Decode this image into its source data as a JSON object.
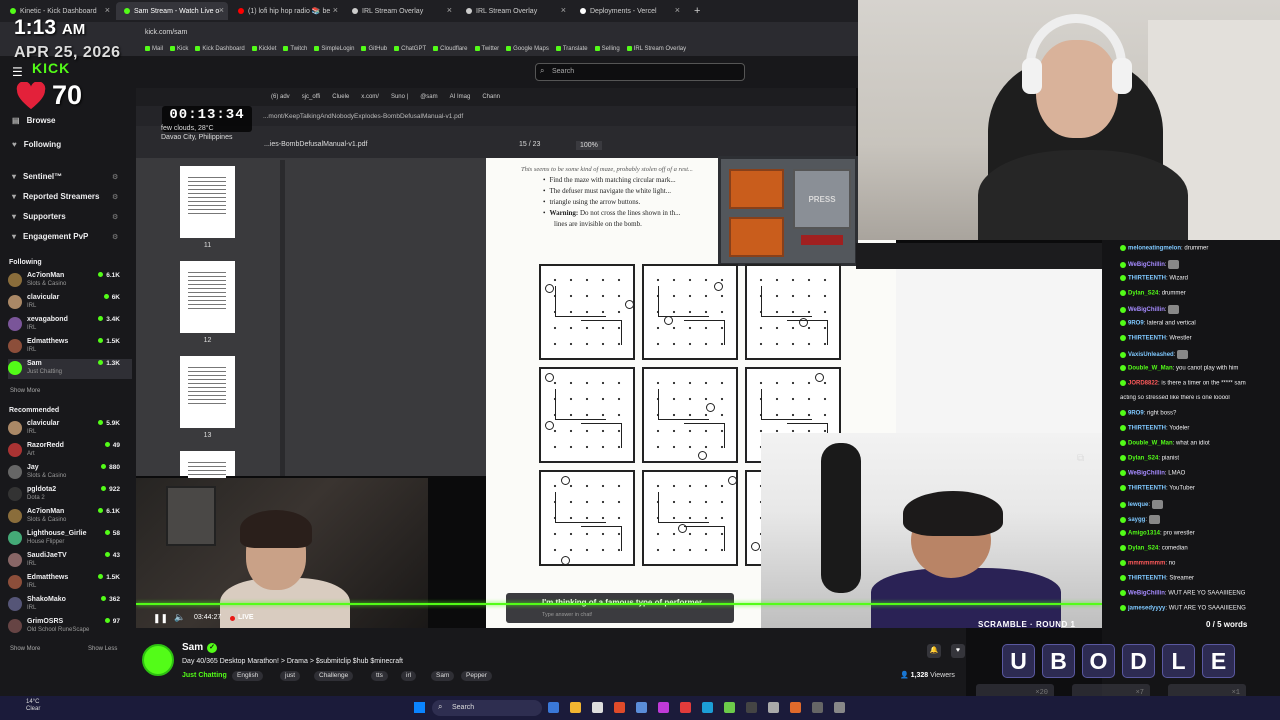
{
  "overlay": {
    "time": "1:13",
    "ampm": "AM",
    "date": "APR 25, 2026",
    "heart_rate": "70"
  },
  "browser": {
    "tabs": [
      {
        "label": "Kinetic - Kick Dashboard",
        "color": "#53fc18"
      },
      {
        "label": "Sam Stream - Watch Live o",
        "color": "#53fc18"
      },
      {
        "label": "(1) lofi hip hop radio 📚 be",
        "color": "#ff0000"
      },
      {
        "label": "IRL Stream Overlay",
        "color": "#cccccc"
      },
      {
        "label": "IRL Stream Overlay",
        "color": "#cccccc"
      },
      {
        "label": "Deployments - Vercel",
        "color": "#ffffff"
      }
    ],
    "new_tab": "+",
    "url": "kick.com/sam",
    "bookmarks": [
      "Mail",
      "Kick",
      "Kick Dashboard",
      "Kicklet",
      "Twitch",
      "SimpleLogin",
      "GitHub",
      "ChatGPT",
      "Cloudflare",
      "Twitter",
      "Google Maps",
      "Translate",
      "Selling",
      "IRL Stream Overlay"
    ]
  },
  "kick": {
    "logo": "KICK",
    "search_placeholder": "Search"
  },
  "sidebar": {
    "nav": [
      {
        "label": "Browse",
        "icon": "▤"
      },
      {
        "label": "Following",
        "icon": "♥"
      }
    ],
    "sections": [
      "Sentinel™",
      "Reported Streamers",
      "Supporters",
      "Engagement PvP"
    ],
    "following_title": "Following",
    "following": [
      {
        "name": "Ac7ionMan",
        "cat": "Slots & Casino",
        "viewers": "6.1K",
        "color": "#8a6d3b"
      },
      {
        "name": "clavicular",
        "cat": "IRL",
        "viewers": "6K",
        "color": "#aa8866"
      },
      {
        "name": "xevagabond",
        "cat": "IRL",
        "viewers": "3.4K",
        "color": "#7a5599"
      },
      {
        "name": "Edmatthews",
        "cat": "IRL",
        "viewers": "1.5K",
        "color": "#8c4e3a"
      },
      {
        "name": "Sam",
        "cat": "Just Chatting",
        "viewers": "1.3K",
        "color": "#53fc18"
      }
    ],
    "show_more": "Show More",
    "recommended_title": "Recommended",
    "recommended": [
      {
        "name": "clavicular",
        "cat": "IRL",
        "viewers": "5.9K",
        "color": "#aa8866"
      },
      {
        "name": "RazorRedd",
        "cat": "Art",
        "viewers": "49",
        "color": "#a33"
      },
      {
        "name": "Jay",
        "cat": "Slots & Casino",
        "viewers": "880",
        "color": "#666"
      },
      {
        "name": "pgldota2",
        "cat": "Dota 2",
        "viewers": "922",
        "color": "#333"
      },
      {
        "name": "Ac7ionMan",
        "cat": "Slots & Casino",
        "viewers": "6.1K",
        "color": "#8a6d3b"
      },
      {
        "name": "Lighthouse_Girlie",
        "cat": "House Flipper",
        "viewers": "58",
        "color": "#4a7"
      },
      {
        "name": "SaudiJaeTV",
        "cat": "IRL",
        "viewers": "43",
        "color": "#866"
      },
      {
        "name": "Edmatthews",
        "cat": "IRL",
        "viewers": "1.5K",
        "color": "#8c4e3a"
      },
      {
        "name": "ShakoMako",
        "cat": "IRL",
        "viewers": "362",
        "color": "#557"
      },
      {
        "name": "GrimOSRS",
        "cat": "Old School RuneScape",
        "viewers": "97",
        "color": "#644"
      }
    ],
    "show_more_2": "Show More",
    "show_less": "Show Less"
  },
  "stream": {
    "pdf_tabs": [
      "(6) adv",
      "sjc_offi",
      "Cluele",
      "x.com/",
      "Suno |",
      "@sam",
      "AI Imag",
      "Chann"
    ],
    "pdf_url": "...mont/KeepTalkingAndNobodyExplodes-BombDefusalManual-v1.pdf",
    "pdf_name": "...ies-BombDefusalManual-v1.pdf",
    "pdf_page": "15  /  23",
    "pdf_zoom": "100%",
    "timer": "00:13:34",
    "weather_line1": "few clouds, 28°C",
    "weather_line2": "Davao City, Philippines",
    "thumb_pages": [
      "11",
      "12",
      "13"
    ],
    "page_intro": "This seems to be some kind of maze, probably stolen off of a rest...",
    "page_bullets": [
      "Find the maze with matching circular mark...",
      "The defuser must navigate the white light...",
      "triangle using the arrow buttons."
    ],
    "page_warning_label": "Warning:",
    "page_warning": "Do not cross the lines shown in th...",
    "page_warning2": "lines are invisible on the bomb.",
    "bomb_button": "PRESS",
    "question": "I'm thinking of a famous type of performer.",
    "answer_hint": "Type answer in chat!",
    "elapsed": "03:44:27",
    "live": "LIVE"
  },
  "channel": {
    "name": "Sam",
    "title": "Day 40/365 Desktop Marathon! > Drama > $submitclip $hub $minecraft",
    "category": "Just Chatting",
    "tags": [
      "English",
      "just",
      "Challenge",
      "tts",
      "irl",
      "Sam",
      "Pepper"
    ],
    "viewers": "1,328",
    "viewers_label": "Viewers"
  },
  "chat": [
    {
      "user": "meloneatingmelon",
      "color": "#7ec8ff",
      "text": "drummer"
    },
    {
      "user": "WeBigChillin",
      "color": "#a58bff",
      "text": ""
    },
    {
      "user": "THIRTEENTH",
      "color": "#7ec8ff",
      "text": "Wizard"
    },
    {
      "user": "Dylan_S24",
      "color": "#53fc18",
      "text": "drummer"
    },
    {
      "user": "WeBigChillin",
      "color": "#a58bff",
      "text": ""
    },
    {
      "user": "9RO9",
      "color": "#7ec8ff",
      "text": "lateral and vertical"
    },
    {
      "user": "THIRTEENTH",
      "color": "#7ec8ff",
      "text": "Wrestler"
    },
    {
      "user": "VaxisUnleashed",
      "color": "#7ec8ff",
      "text": ""
    },
    {
      "user": "Double_W_Man",
      "color": "#53fc18",
      "text": "you canot play with him"
    },
    {
      "user": "JORD8822",
      "color": "#ff5a5a",
      "text": "is there a timer on the ***** sam"
    },
    {
      "user": "",
      "color": "#efeff1",
      "text": "acting so stressed like there is one looool"
    },
    {
      "user": "9RO9",
      "color": "#7ec8ff",
      "text": "right boss?"
    },
    {
      "user": "THIRTEENTH",
      "color": "#7ec8ff",
      "text": "Yodeler"
    },
    {
      "user": "Double_W_Man",
      "color": "#53fc18",
      "text": "what an idiot"
    },
    {
      "user": "Dylan_S24",
      "color": "#53fc18",
      "text": "pianist"
    },
    {
      "user": "WeBigChillin",
      "color": "#a58bff",
      "text": "LMAO"
    },
    {
      "user": "THIRTEENTH",
      "color": "#7ec8ff",
      "text": "YouTuber"
    },
    {
      "user": "lewque",
      "color": "#7ec8ff",
      "text": ""
    },
    {
      "user": "saygg",
      "color": "#7ec8ff",
      "text": ""
    },
    {
      "user": "Amigo1314",
      "color": "#53fc18",
      "text": "pro wrestler"
    },
    {
      "user": "Dylan_S24",
      "color": "#53fc18",
      "text": "comedian"
    },
    {
      "user": "mmmmmmm",
      "color": "#ff5a5a",
      "text": "no"
    },
    {
      "user": "THIRTEENTH",
      "color": "#7ec8ff",
      "text": "Streamer"
    },
    {
      "user": "WeBigChillin",
      "color": "#a58bff",
      "text": "WUT ARE YO SAAAIIIEENG"
    },
    {
      "user": "jamesedyyyy",
      "color": "#7ec8ff",
      "text": "WUT ARE YO SAAAIIIEENG"
    }
  ],
  "scramble": {
    "title": "SCRAMBLE · ROUND 1",
    "count": "0 / 5 words",
    "letters": [
      "U",
      "B",
      "O",
      "D",
      "L",
      "E"
    ],
    "slots": [
      "×20",
      "×7",
      "×1"
    ]
  },
  "taskbar": {
    "weather_temp": "14°C",
    "weather_desc": "Clear",
    "search": "Search"
  }
}
